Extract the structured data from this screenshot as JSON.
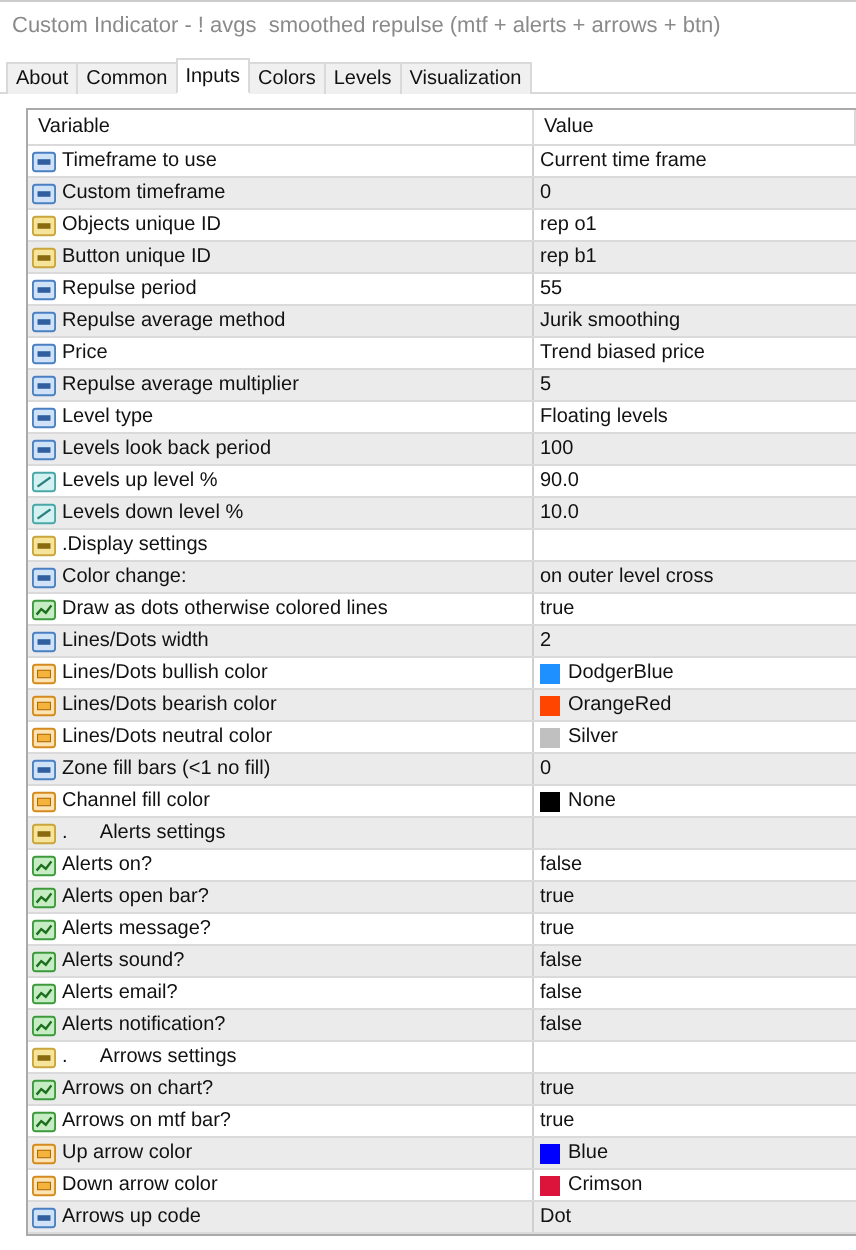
{
  "window": {
    "title": "Custom Indicator - ! avgs  smoothed repulse (mtf + alerts + arrows + btn)"
  },
  "tabs": [
    {
      "label": "About",
      "selected": false
    },
    {
      "label": "Common",
      "selected": false
    },
    {
      "label": "Inputs",
      "selected": true
    },
    {
      "label": "Colors",
      "selected": false
    },
    {
      "label": "Levels",
      "selected": false
    },
    {
      "label": "Visualization",
      "selected": false
    }
  ],
  "table": {
    "columns": [
      "Variable",
      "Value"
    ],
    "rows": [
      {
        "kind": "int",
        "variable": "Timeframe to use",
        "value": "Current time frame"
      },
      {
        "kind": "int",
        "variable": "Custom timeframe",
        "value": "0"
      },
      {
        "kind": "string",
        "variable": "Objects unique ID",
        "value": "rep o1"
      },
      {
        "kind": "string",
        "variable": "Button unique ID",
        "value": "rep b1"
      },
      {
        "kind": "int",
        "variable": "Repulse period",
        "value": "55"
      },
      {
        "kind": "int",
        "variable": "Repulse average method",
        "value": "Jurik smoothing"
      },
      {
        "kind": "int",
        "variable": "Price",
        "value": "Trend biased price"
      },
      {
        "kind": "int",
        "variable": "Repulse average multiplier",
        "value": "5"
      },
      {
        "kind": "int",
        "variable": "Level type",
        "value": "Floating levels"
      },
      {
        "kind": "int",
        "variable": "Levels look back period",
        "value": "100"
      },
      {
        "kind": "double",
        "variable": "Levels up level %",
        "value": "90.0"
      },
      {
        "kind": "double",
        "variable": "Levels down level %",
        "value": "10.0"
      },
      {
        "kind": "string",
        "variable": ".Display settings"
      },
      {
        "kind": "int",
        "variable": "Color change:",
        "value": "on outer level cross"
      },
      {
        "kind": "bool",
        "variable": "Draw as dots otherwise colored lines",
        "value": "true"
      },
      {
        "kind": "int",
        "variable": "Lines/Dots width",
        "value": "2"
      },
      {
        "kind": "color",
        "variable": "Lines/Dots bullish color",
        "value": "DodgerBlue",
        "color": "#1e90ff"
      },
      {
        "kind": "color",
        "variable": "Lines/Dots bearish color",
        "value": "OrangeRed",
        "color": "#ff4500"
      },
      {
        "kind": "color",
        "variable": "Lines/Dots neutral color",
        "value": "Silver",
        "color": "#c0c0c0"
      },
      {
        "kind": "int",
        "variable": "Zone fill bars (<1 no fill)",
        "value": "0"
      },
      {
        "kind": "color",
        "variable": "Channel fill color",
        "value": "None",
        "color": "#000000"
      },
      {
        "kind": "string",
        "variable": ".      Alerts settings"
      },
      {
        "kind": "bool",
        "variable": "Alerts on?",
        "value": "false"
      },
      {
        "kind": "bool",
        "variable": "Alerts open bar?",
        "value": "true"
      },
      {
        "kind": "bool",
        "variable": "Alerts message?",
        "value": "true"
      },
      {
        "kind": "bool",
        "variable": "Alerts sound?",
        "value": "false"
      },
      {
        "kind": "bool",
        "variable": "Alerts email?",
        "value": "false"
      },
      {
        "kind": "bool",
        "variable": "Alerts notification?",
        "value": "false"
      },
      {
        "kind": "string",
        "variable": ".      Arrows settings"
      },
      {
        "kind": "bool",
        "variable": "Arrows on chart?",
        "value": "true"
      },
      {
        "kind": "bool",
        "variable": "Arrows on mtf bar?",
        "value": "true"
      },
      {
        "kind": "color",
        "variable": "Up arrow color",
        "value": "Blue",
        "color": "#0000ff"
      },
      {
        "kind": "color",
        "variable": "Down arrow color",
        "value": "Crimson",
        "color": "#dc143c"
      },
      {
        "kind": "int",
        "variable": "Arrows up code",
        "value": "Dot"
      }
    ]
  }
}
